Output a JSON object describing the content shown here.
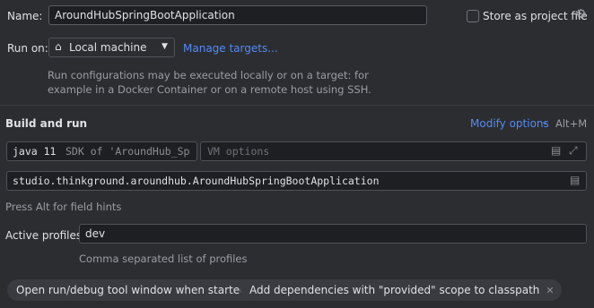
{
  "name": {
    "label": "Name:",
    "value": "AroundHubSpringBootApplication",
    "store_label": "Store as project file",
    "store_checked": false,
    "store_icon": "gear-icon"
  },
  "run_on": {
    "label": "Run on:",
    "target_icon": "home-icon",
    "target_value": "Local machine",
    "manage_link": "Manage targets...",
    "hint_line1": "Run configurations may be executed locally or on a target: for",
    "hint_line2": "example in a Docker Container or on a remote host using SSH."
  },
  "build_and_run": {
    "title": "Build and run",
    "modify_options": "Modify options",
    "shortcut": "Alt+M",
    "sdk_version": "java 11",
    "sdk_desc": "SDK of 'AroundHub_Sp",
    "vm_placeholder": "VM options",
    "main_class": "studio.thinkground.aroundhub.AroundHubSpringBootApplication",
    "field_hint": "Press Alt for field hints"
  },
  "profiles": {
    "label": "Active profiles:",
    "value": "dev",
    "hint": "Comma separated list of profiles"
  },
  "chips": [
    {
      "label": "Open run/debug tool window when started"
    },
    {
      "label": "Add dependencies with \"provided\" scope to classpath"
    }
  ]
}
